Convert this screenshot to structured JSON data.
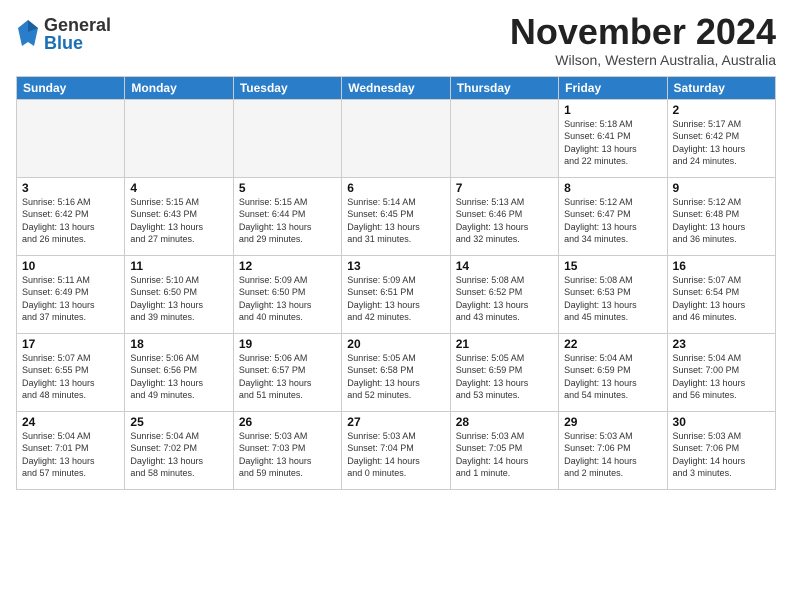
{
  "header": {
    "logo": {
      "general": "General",
      "blue": "Blue"
    },
    "title": "November 2024",
    "location": "Wilson, Western Australia, Australia"
  },
  "weekdays": [
    "Sunday",
    "Monday",
    "Tuesday",
    "Wednesday",
    "Thursday",
    "Friday",
    "Saturday"
  ],
  "weeks": [
    [
      {
        "day": "",
        "info": ""
      },
      {
        "day": "",
        "info": ""
      },
      {
        "day": "",
        "info": ""
      },
      {
        "day": "",
        "info": ""
      },
      {
        "day": "",
        "info": ""
      },
      {
        "day": "1",
        "info": "Sunrise: 5:18 AM\nSunset: 6:41 PM\nDaylight: 13 hours\nand 22 minutes."
      },
      {
        "day": "2",
        "info": "Sunrise: 5:17 AM\nSunset: 6:42 PM\nDaylight: 13 hours\nand 24 minutes."
      }
    ],
    [
      {
        "day": "3",
        "info": "Sunrise: 5:16 AM\nSunset: 6:42 PM\nDaylight: 13 hours\nand 26 minutes."
      },
      {
        "day": "4",
        "info": "Sunrise: 5:15 AM\nSunset: 6:43 PM\nDaylight: 13 hours\nand 27 minutes."
      },
      {
        "day": "5",
        "info": "Sunrise: 5:15 AM\nSunset: 6:44 PM\nDaylight: 13 hours\nand 29 minutes."
      },
      {
        "day": "6",
        "info": "Sunrise: 5:14 AM\nSunset: 6:45 PM\nDaylight: 13 hours\nand 31 minutes."
      },
      {
        "day": "7",
        "info": "Sunrise: 5:13 AM\nSunset: 6:46 PM\nDaylight: 13 hours\nand 32 minutes."
      },
      {
        "day": "8",
        "info": "Sunrise: 5:12 AM\nSunset: 6:47 PM\nDaylight: 13 hours\nand 34 minutes."
      },
      {
        "day": "9",
        "info": "Sunrise: 5:12 AM\nSunset: 6:48 PM\nDaylight: 13 hours\nand 36 minutes."
      }
    ],
    [
      {
        "day": "10",
        "info": "Sunrise: 5:11 AM\nSunset: 6:49 PM\nDaylight: 13 hours\nand 37 minutes."
      },
      {
        "day": "11",
        "info": "Sunrise: 5:10 AM\nSunset: 6:50 PM\nDaylight: 13 hours\nand 39 minutes."
      },
      {
        "day": "12",
        "info": "Sunrise: 5:09 AM\nSunset: 6:50 PM\nDaylight: 13 hours\nand 40 minutes."
      },
      {
        "day": "13",
        "info": "Sunrise: 5:09 AM\nSunset: 6:51 PM\nDaylight: 13 hours\nand 42 minutes."
      },
      {
        "day": "14",
        "info": "Sunrise: 5:08 AM\nSunset: 6:52 PM\nDaylight: 13 hours\nand 43 minutes."
      },
      {
        "day": "15",
        "info": "Sunrise: 5:08 AM\nSunset: 6:53 PM\nDaylight: 13 hours\nand 45 minutes."
      },
      {
        "day": "16",
        "info": "Sunrise: 5:07 AM\nSunset: 6:54 PM\nDaylight: 13 hours\nand 46 minutes."
      }
    ],
    [
      {
        "day": "17",
        "info": "Sunrise: 5:07 AM\nSunset: 6:55 PM\nDaylight: 13 hours\nand 48 minutes."
      },
      {
        "day": "18",
        "info": "Sunrise: 5:06 AM\nSunset: 6:56 PM\nDaylight: 13 hours\nand 49 minutes."
      },
      {
        "day": "19",
        "info": "Sunrise: 5:06 AM\nSunset: 6:57 PM\nDaylight: 13 hours\nand 51 minutes."
      },
      {
        "day": "20",
        "info": "Sunrise: 5:05 AM\nSunset: 6:58 PM\nDaylight: 13 hours\nand 52 minutes."
      },
      {
        "day": "21",
        "info": "Sunrise: 5:05 AM\nSunset: 6:59 PM\nDaylight: 13 hours\nand 53 minutes."
      },
      {
        "day": "22",
        "info": "Sunrise: 5:04 AM\nSunset: 6:59 PM\nDaylight: 13 hours\nand 54 minutes."
      },
      {
        "day": "23",
        "info": "Sunrise: 5:04 AM\nSunset: 7:00 PM\nDaylight: 13 hours\nand 56 minutes."
      }
    ],
    [
      {
        "day": "24",
        "info": "Sunrise: 5:04 AM\nSunset: 7:01 PM\nDaylight: 13 hours\nand 57 minutes."
      },
      {
        "day": "25",
        "info": "Sunrise: 5:04 AM\nSunset: 7:02 PM\nDaylight: 13 hours\nand 58 minutes."
      },
      {
        "day": "26",
        "info": "Sunrise: 5:03 AM\nSunset: 7:03 PM\nDaylight: 13 hours\nand 59 minutes."
      },
      {
        "day": "27",
        "info": "Sunrise: 5:03 AM\nSunset: 7:04 PM\nDaylight: 14 hours\nand 0 minutes."
      },
      {
        "day": "28",
        "info": "Sunrise: 5:03 AM\nSunset: 7:05 PM\nDaylight: 14 hours\nand 1 minute."
      },
      {
        "day": "29",
        "info": "Sunrise: 5:03 AM\nSunset: 7:06 PM\nDaylight: 14 hours\nand 2 minutes."
      },
      {
        "day": "30",
        "info": "Sunrise: 5:03 AM\nSunset: 7:06 PM\nDaylight: 14 hours\nand 3 minutes."
      }
    ]
  ]
}
